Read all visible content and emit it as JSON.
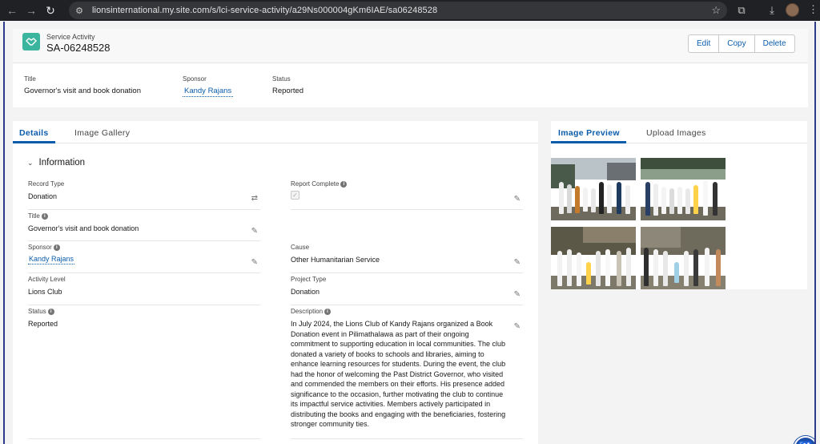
{
  "browser": {
    "url": "lionsinternational.my.site.com/s/lci-service-activity/a29Ns000004gKm6IAE/sa06248528"
  },
  "header": {
    "object_type": "Service Activity",
    "record_name": "SA-06248528",
    "buttons": [
      "Edit",
      "Copy",
      "Delete"
    ]
  },
  "highlights": {
    "title_label": "Title",
    "title_value": "Governor's visit and book donation",
    "sponsor_label": "Sponsor",
    "sponsor_value": "Kandy Rajans",
    "status_label": "Status",
    "status_value": "Reported"
  },
  "details": {
    "tabs": [
      "Details",
      "Image Gallery"
    ],
    "section_title": "Information",
    "fields": {
      "record_type": {
        "label": "Record Type",
        "value": "Donation"
      },
      "report_complete": {
        "label": "Report Complete",
        "checked": true
      },
      "title": {
        "label": "Title",
        "value": "Governor's visit and book donation"
      },
      "sponsor": {
        "label": "Sponsor",
        "value": "Kandy Rajans"
      },
      "cause": {
        "label": "Cause",
        "value": "Other Humanitarian Service"
      },
      "activity_level": {
        "label": "Activity Level",
        "value": "Lions Club"
      },
      "project_type": {
        "label": "Project Type",
        "value": "Donation"
      },
      "status": {
        "label": "Status",
        "value": "Reported"
      },
      "description": {
        "label": "Description",
        "value": "In July 2024, the Lions Club of Kandy Rajans organized a Book Donation event in Pilimathalawa as part of their ongoing commitment to supporting education in local communities. The club donated a variety of books to schools and libraries, aiming to enhance learning resources for students. During the event, the club had the honor of welcoming the Past District Governor, who visited and commended the members on their efforts. His presence added significance to the occasion, further motivating the club to continue its impactful service activities. Members actively participated in distributing the books and engaging with the beneficiaries, fostering stronger community ties."
      }
    }
  },
  "images": {
    "tabs": [
      "Image Preview",
      "Upload Images"
    ]
  },
  "colors": {
    "brand_blue": "#0b5cab",
    "record_icon": "#3bb59d",
    "frame": "#2e3a8c"
  }
}
